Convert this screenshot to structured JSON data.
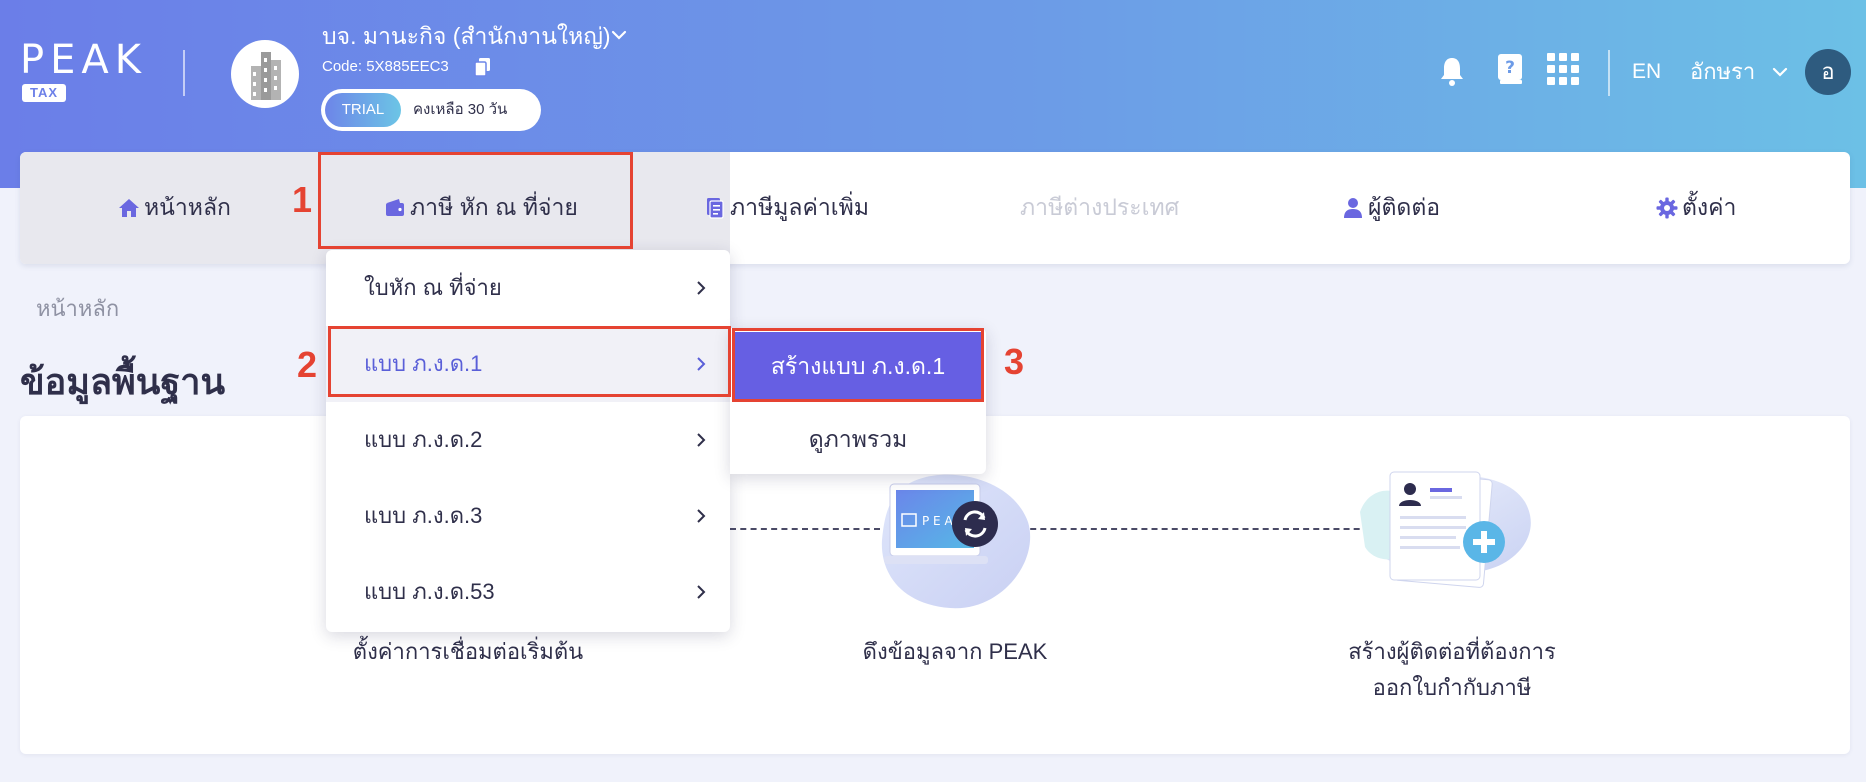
{
  "app": {
    "logo_text": "PEAK",
    "logo_tag": "TAX"
  },
  "company": {
    "name": "บจ. มานะกิจ (สำนักงานใหญ่)",
    "code": "Code: 5X885EEC3",
    "trial_label": "TRIAL",
    "trial_remaining": "คงเหลือ 30 วัน"
  },
  "header": {
    "icons": [
      "bell-icon",
      "help-book-icon",
      "apps-grid-icon"
    ],
    "language": "EN",
    "username": "อักษรา",
    "avatar_initial": "อ"
  },
  "nav": {
    "items": [
      {
        "label": "หน้าหลัก",
        "icon": "home-icon"
      },
      {
        "label": "ภาษี หัก ณ ที่จ่าย",
        "icon": "wallet-icon"
      },
      {
        "label": "ภาษีมูลค่าเพิ่ม",
        "icon": "document-icon"
      },
      {
        "label": "ภาษีต่างประเทศ",
        "icon": ""
      },
      {
        "label": "ผู้ติดต่อ",
        "icon": "user-icon"
      },
      {
        "label": "ตั้งค่า",
        "icon": "gear-icon"
      }
    ]
  },
  "dropdown": {
    "items": [
      {
        "label": "ใบหัก ณ ที่จ่าย"
      },
      {
        "label": "แบบ ภ.ง.ด.1"
      },
      {
        "label": "แบบ ภ.ง.ด.2"
      },
      {
        "label": "แบบ ภ.ง.ด.3"
      },
      {
        "label": "แบบ ภ.ง.ด.53"
      }
    ]
  },
  "submenu": {
    "create_label": "สร้างแบบ ภ.ง.ด.1",
    "overview_label": "ดูภาพรวม"
  },
  "annotations": [
    "1",
    "2",
    "3"
  ],
  "page": {
    "breadcrumb": "หน้าหลัก",
    "title": "ข้อมูลพื้นฐาน"
  },
  "steps": {
    "step1": "ตั้งค่าการเชื่อมต่อเริ่มต้น",
    "step2": "ดึงข้อมูลจาก PEAK",
    "step3_line1": "สร้างผู้ติดต่อที่ต้องการ",
    "step3_line2": "ออกใบกำกับภาษี"
  },
  "colors": {
    "header_start": "#6b7ee8",
    "header_end": "#6cc0e6",
    "accent": "#665fe3",
    "annotation_red": "#e54332",
    "avatar_bg": "#2e5b7f"
  }
}
